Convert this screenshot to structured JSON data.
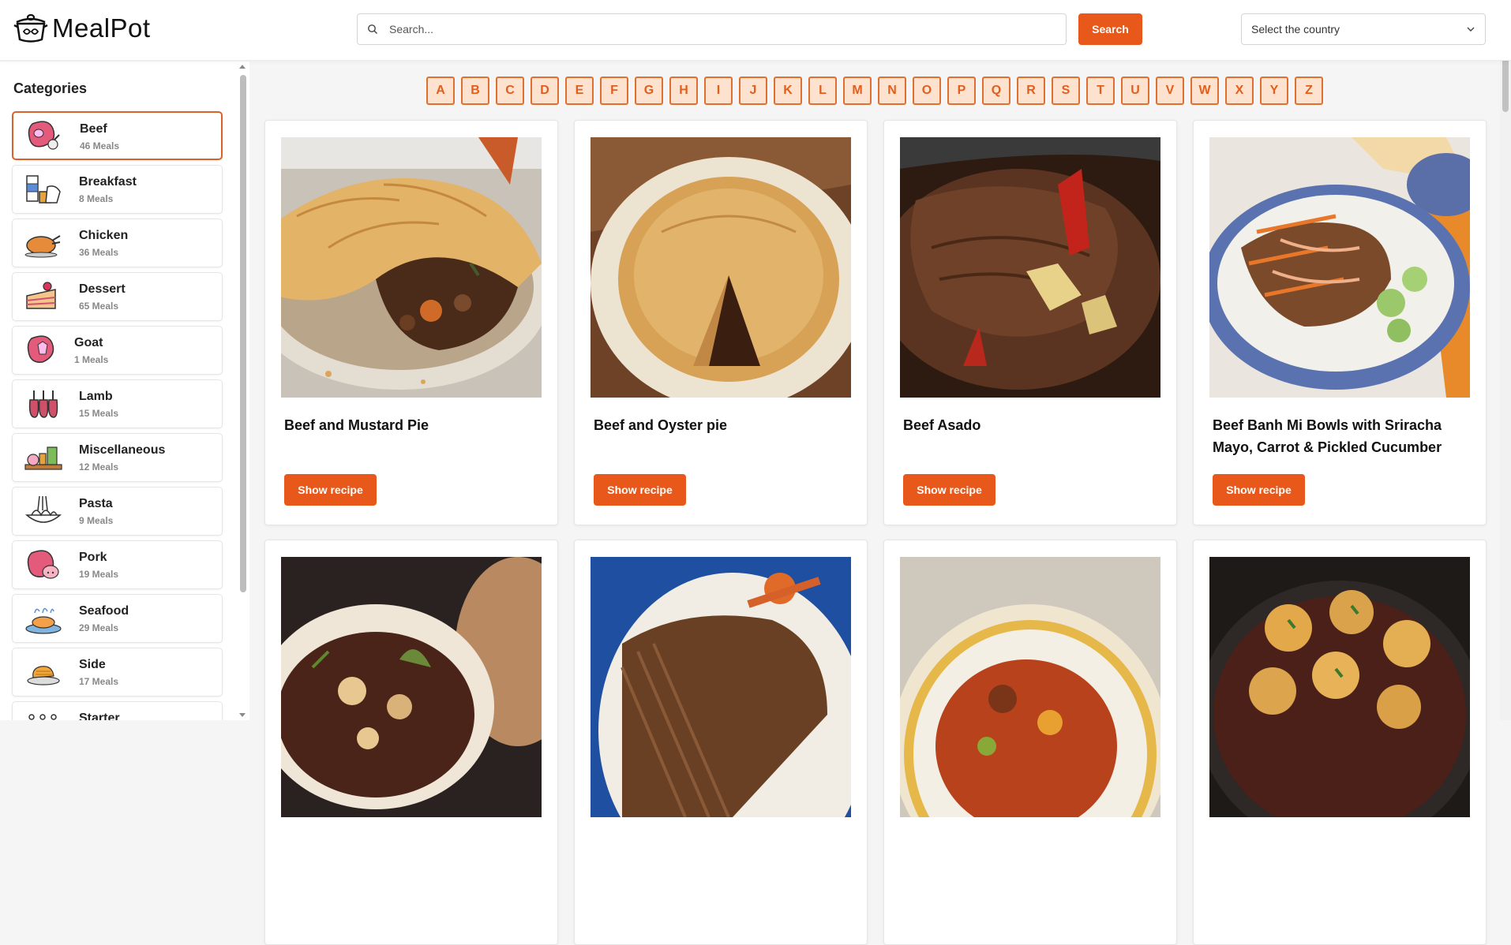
{
  "app": {
    "name": "MealPot"
  },
  "header": {
    "search_placeholder": "Search...",
    "search_button": "Search",
    "country_select": "Select the country"
  },
  "sidebar": {
    "title": "Categories",
    "items": [
      {
        "name": "Beef",
        "count": "46 Meals",
        "icon": "beef-icon",
        "active": true
      },
      {
        "name": "Breakfast",
        "count": "8 Meals",
        "icon": "breakfast-icon"
      },
      {
        "name": "Chicken",
        "count": "36 Meals",
        "icon": "chicken-icon"
      },
      {
        "name": "Dessert",
        "count": "65 Meals",
        "icon": "dessert-icon"
      },
      {
        "name": "Goat",
        "count": "1 Meals",
        "icon": "goat-icon"
      },
      {
        "name": "Lamb",
        "count": "15 Meals",
        "icon": "lamb-icon"
      },
      {
        "name": "Miscellaneous",
        "count": "12 Meals",
        "icon": "miscellaneous-icon"
      },
      {
        "name": "Pasta",
        "count": "9 Meals",
        "icon": "pasta-icon"
      },
      {
        "name": "Pork",
        "count": "19 Meals",
        "icon": "pork-icon"
      },
      {
        "name": "Seafood",
        "count": "29 Meals",
        "icon": "seafood-icon"
      },
      {
        "name": "Side",
        "count": "17 Meals",
        "icon": "side-icon"
      },
      {
        "name": "Starter",
        "count": "",
        "icon": "starter-icon"
      }
    ]
  },
  "letters": [
    "A",
    "B",
    "C",
    "D",
    "E",
    "F",
    "G",
    "H",
    "I",
    "J",
    "K",
    "L",
    "M",
    "N",
    "O",
    "P",
    "Q",
    "R",
    "S",
    "T",
    "U",
    "V",
    "W",
    "X",
    "Y",
    "Z"
  ],
  "meals": [
    {
      "title": "Beef and Mustard Pie",
      "button": "Show recipe",
      "image": "beef-pie-photo"
    },
    {
      "title": "Beef and Oyster pie",
      "button": "Show recipe",
      "image": "oyster-pie-photo"
    },
    {
      "title": "Beef Asado",
      "button": "Show recipe",
      "image": "beef-asado-photo"
    },
    {
      "title": "Beef Banh Mi Bowls with Sriracha Mayo, Carrot & Pickled Cucumber",
      "button": "Show recipe",
      "image": "banh-mi-bowl-photo"
    },
    {
      "title": "",
      "button": "",
      "image": "beef-bourguignon-photo"
    },
    {
      "title": "",
      "button": "",
      "image": "beef-brisket-photo"
    },
    {
      "title": "",
      "button": "",
      "image": "beef-stew-photo"
    },
    {
      "title": "",
      "button": "",
      "image": "beef-dumpling-stew-photo"
    }
  ],
  "colors": {
    "accent": "#e8581a",
    "letter_bg": "#fce2cf",
    "letter_border": "#e0702f",
    "active_border": "#d9622b"
  }
}
